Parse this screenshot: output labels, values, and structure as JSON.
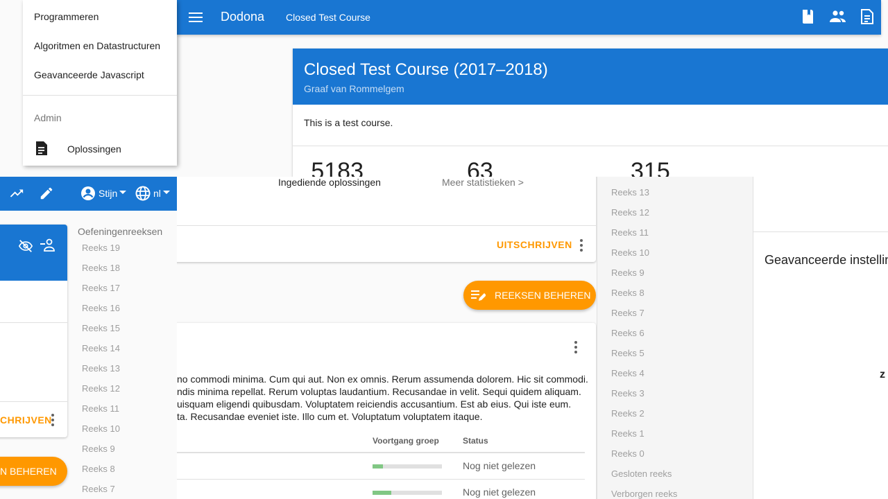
{
  "drawer": {
    "courses": [
      "Programmeren",
      "Algoritmen en Datastructuren",
      "Geavanceerde Javascript"
    ],
    "admin_header": "Admin",
    "admin_item": "Oplossingen"
  },
  "appbar": {
    "brand": "Dodona",
    "course_title": "Closed Test Course"
  },
  "course": {
    "title": "Closed Test Course (2017–2018)",
    "teacher": "Graaf van Rommelgem",
    "description": "This is a test course.",
    "stats": [
      {
        "value": "5183",
        "label": "Ingediende oplossingen"
      },
      {
        "value": "63",
        "label": "Meer statistieken >"
      },
      {
        "value": "315",
        "label": ""
      }
    ],
    "unsubscribe_label": "UITSCHRIJVEN"
  },
  "left_toolbar": {
    "user": "Stijn",
    "lang": "nl",
    "unsubscribe_label": "CHRIJVEN",
    "manage_label": "N BEHEREN"
  },
  "series_nav_left": {
    "header": "Oefeningenreeksen",
    "items": [
      "Reeks 19",
      "Reeks 18",
      "Reeks 17",
      "Reeks 16",
      "Reeks 15",
      "Reeks 14",
      "Reeks 13",
      "Reeks 12",
      "Reeks 11",
      "Reeks 10",
      "Reeks 9",
      "Reeks 8",
      "Reeks 7"
    ]
  },
  "series_nav_right": {
    "items": [
      "Reeks 13",
      "Reeks 12",
      "Reeks 11",
      "Reeks 10",
      "Reeks 9",
      "Reeks 8",
      "Reeks 7",
      "Reeks 6",
      "Reeks 5",
      "Reeks 4",
      "Reeks 3",
      "Reeks 2",
      "Reeks 1",
      "Reeks 0",
      "Gesloten reeks",
      "Verborgen reeks"
    ]
  },
  "manage_series_label": "REEKSEN BEHEREN",
  "advanced_settings": "Geavanceerde instellingen",
  "series_card": {
    "description_lines": [
      "no commodi minima. Cum qui aut. Non ex omnis. Rerum assumenda dolorem. Hic sit commodi.",
      "ndis minima repellat. Rerum voluptas laudantium. Recusandae in velit. Sequi quidem aliquam.",
      "uisquam eligendi quibusdam. Voluptatem reiciendis accusantium. Est ab eius. Qui iste eum.",
      "ta. Recusandae eveniet iste. Illo cum et. Voluptatum voluptatem itaque."
    ],
    "col_progress": "Voortgang groep",
    "col_status": "Status",
    "rows": [
      {
        "progress": 0.15,
        "status": "Nog niet gelezen"
      },
      {
        "progress": 0.27,
        "status": "Nog niet gelezen"
      }
    ]
  },
  "colors": {
    "primary": "#1976d2",
    "accent": "#ff9800",
    "progress": "#81c784"
  }
}
